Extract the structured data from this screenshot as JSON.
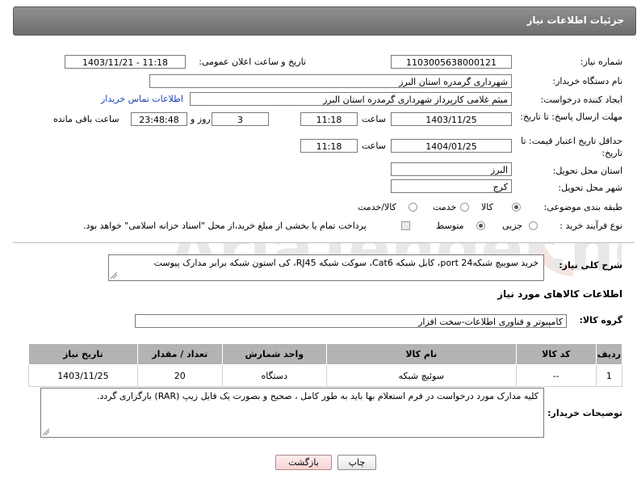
{
  "header": {
    "title": "جزئیات اطلاعات نیاز"
  },
  "fields": {
    "need_number_label": "شماره نیاز:",
    "need_number": "1103005638000121",
    "announce_label": "تاریخ و ساعت اعلان عمومی:",
    "announce_value": "1403/11/21 - 11:18",
    "buyer_org_label": "نام دستگاه خریدار:",
    "buyer_org": "شهرداری گرمدره استان البرز",
    "creator_label": "ایجاد کننده درخواست:",
    "creator": "میثم غلامی کارپرداز شهرداری گرمدره استان البرز",
    "contact_link": "اطلاعات تماس خریدار",
    "deadline_label": "مهلت ارسال پاسخ: تا تاریخ:",
    "deadline_date": "1403/11/25",
    "time_label": "ساعت",
    "deadline_time": "11:18",
    "days_value": "3",
    "days_label": "روز و",
    "remaining_time": "23:48:48",
    "remaining_label": "ساعت باقی مانده",
    "validity_label": "حداقل تاریخ اعتبار قیمت: تا تاریخ:",
    "validity_date": "1404/01/25",
    "validity_time": "11:18",
    "province_label": "استان محل تحویل:",
    "province": "البرز",
    "city_label": "شهر محل تحویل:",
    "city": "کرج",
    "category_label": "طبقه بندی موضوعی:",
    "category_options": [
      "کالا",
      "خدمت",
      "کالا/خدمت"
    ],
    "process_label": "نوع فرآیند خرید :",
    "process_options": [
      "جزیی",
      "متوسط"
    ],
    "payment_text": "پرداخت تمام یا بخشی از مبلغ خرید،از محل \"اسناد خزانه اسلامی\" خواهد بود."
  },
  "description": {
    "label": "شرح کلی نیاز:",
    "text": "خرید سوییچ شبکه24 port، کابل شبکه Cat6، سوکت شبکه RJ45، کی استون شبکه برابر مدارک پیوست"
  },
  "goods_section": {
    "title": "اطلاعات کالاهای مورد نیاز",
    "group_label": "گروه کالا:",
    "group_value": "کامپیوتر و فناوری اطلاعات-سخت افزار"
  },
  "table": {
    "headers": [
      "ردیف",
      "کد کالا",
      "نام کالا",
      "واحد شمارش",
      "تعداد / مقدار",
      "تاریخ نیاز"
    ],
    "rows": [
      [
        "1",
        "--",
        "سوئیچ شبکه",
        "دستگاه",
        "20",
        "1403/11/25"
      ]
    ]
  },
  "buyer_notes": {
    "label": "توضیحات خریدار:",
    "text": "کلیه مدارک مورد درخواست در فرم استعلام بها باید به طور کامل ، صحیح و بصورت یک فایل زیپ (RAR) بارگزاری گردد."
  },
  "buttons": {
    "print": "چاپ",
    "back": "بازگشت"
  },
  "watermark": {
    "text": "AriaTender.net"
  }
}
